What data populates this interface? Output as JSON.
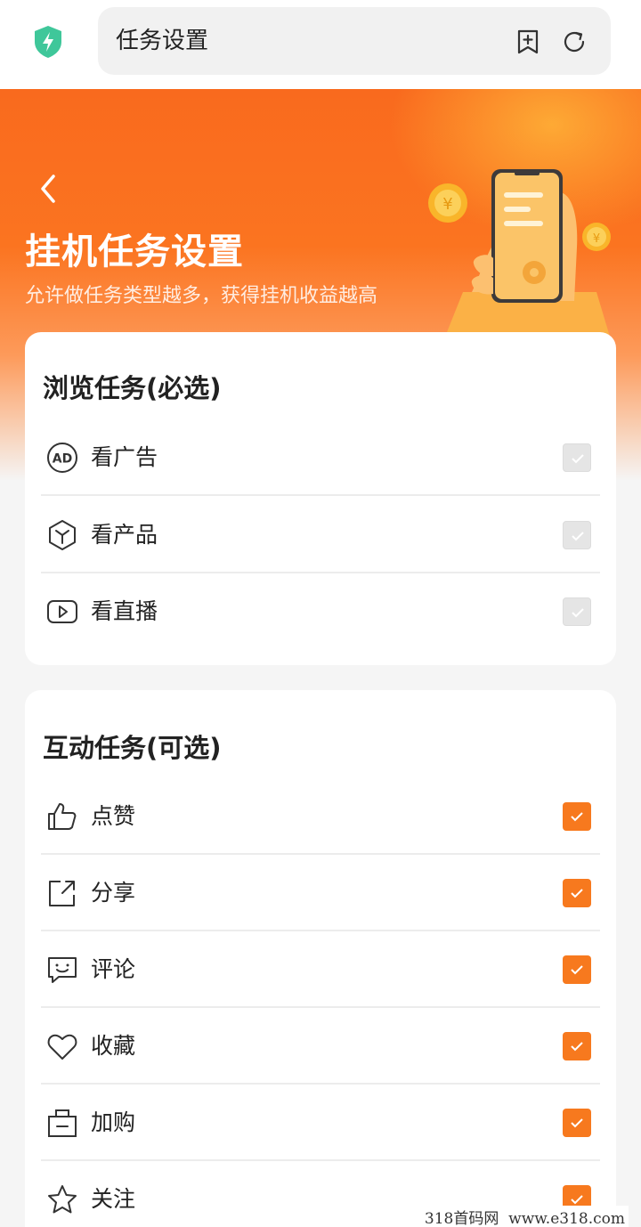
{
  "browser": {
    "url_title": "任务设置",
    "icons": [
      "shield-bolt-icon",
      "bookmark-add-icon",
      "refresh-icon"
    ]
  },
  "hero": {
    "title": "挂机任务设置",
    "subtitle": "允许做任务类型越多，获得挂机收益越高",
    "back_icon": "chevron-left-icon"
  },
  "browse_section": {
    "title": "浏览任务(必选)",
    "items": [
      {
        "label": "看广告",
        "icon": "ad-icon",
        "checked": true,
        "disabled": true
      },
      {
        "label": "看产品",
        "icon": "cube-icon",
        "checked": true,
        "disabled": true
      },
      {
        "label": "看直播",
        "icon": "live-play-icon",
        "checked": true,
        "disabled": true
      }
    ]
  },
  "interact_section": {
    "title": "互动任务(可选)",
    "items": [
      {
        "label": "点赞",
        "icon": "thumbs-up-icon",
        "checked": true
      },
      {
        "label": "分享",
        "icon": "share-icon",
        "checked": true
      },
      {
        "label": "评论",
        "icon": "comment-icon",
        "checked": true
      },
      {
        "label": "收藏",
        "icon": "heart-icon",
        "checked": true
      },
      {
        "label": "加购",
        "icon": "shopping-bag-icon",
        "checked": true
      },
      {
        "label": "关注",
        "icon": "star-icon",
        "checked": true
      }
    ]
  },
  "watermark": "318首码网  www.e318.com",
  "colors": {
    "accent": "#f7791e",
    "hero_orange": "#f96a1e",
    "disabled_box": "#e5e5e5",
    "text": "#222222"
  }
}
